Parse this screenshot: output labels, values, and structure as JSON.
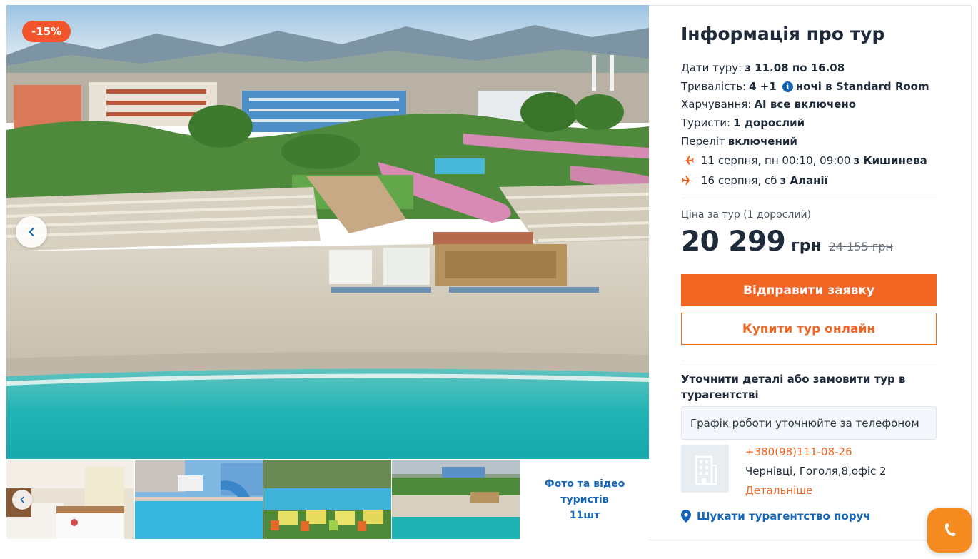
{
  "gallery": {
    "discount_badge": "-15%",
    "media_link": {
      "line1": "Фото та відео",
      "line2": "туристів",
      "line3": "11шт"
    }
  },
  "tour_info": {
    "title": "Інформація про тур",
    "dates_label": "Дати туру:",
    "dates_value": "з 11.08 по 16.08",
    "duration_label": "Тривалість:",
    "duration_value": "4 +1",
    "duration_suffix": "ночі в Standard Room",
    "meal_label": "Харчування:",
    "meal_value": "AI все включено",
    "tourists_label": "Туристи:",
    "tourists_value": "1 дорослий",
    "flight_label": "Переліт",
    "flight_value": "включений",
    "departure_text": "11 серпня, пн 00:10, 09:00",
    "departure_city": "з Кишинева",
    "return_text": "16 серпня, сб",
    "return_city": "з Аланії"
  },
  "price": {
    "label": "Ціна за тур (1 дорослий)",
    "current": "20 299",
    "currency": "грн",
    "old": "24 155 грн"
  },
  "buttons": {
    "send_request": "Відправити заявку",
    "buy_online": "Купити тур онлайн"
  },
  "agency": {
    "title": "Уточнити деталі або замовити тур в турагентстві",
    "schedule": "Графік роботи уточнюйте за телефоном",
    "phone": "+380(98)111-08-26",
    "address": "Чернівці, Гоголя,8,офіс 2",
    "more": "Детальніше",
    "find_nearby": "Шукати турагентство поруч"
  },
  "colors": {
    "accent_orange": "#f26522",
    "badge_red": "#f2552c",
    "link_blue": "#1565b8",
    "call_widget": "#f58a1f"
  },
  "icons": [
    "chevron-left-icon",
    "info-icon",
    "plane-departure-icon",
    "plane-return-icon",
    "building-icon",
    "map-pin-icon",
    "phone-icon"
  ]
}
